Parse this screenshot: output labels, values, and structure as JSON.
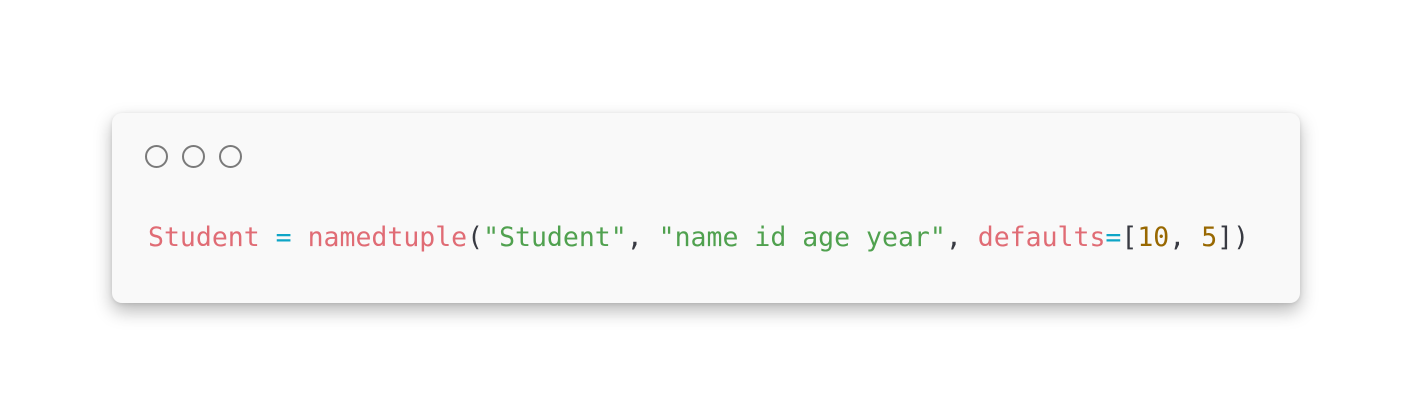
{
  "window": {
    "controls": [
      "close",
      "minimize",
      "maximize"
    ]
  },
  "code": {
    "tokens": {
      "var_name": "Student",
      "assign": "=",
      "func": "namedtuple",
      "open_paren": "(",
      "arg1": "\"Student\"",
      "comma1": ",",
      "arg2": "\"name id age year\"",
      "comma2": ",",
      "kwarg": "defaults",
      "kw_eq": "=",
      "open_bracket": "[",
      "num1": "10",
      "comma3": ",",
      "num2": "5",
      "close_bracket": "]",
      "close_paren": ")"
    }
  },
  "colors": {
    "identifier": "#e06c75",
    "operator": "#0ea5c6",
    "string": "#50a14f",
    "number": "#986801",
    "punctuation": "#383a42"
  }
}
